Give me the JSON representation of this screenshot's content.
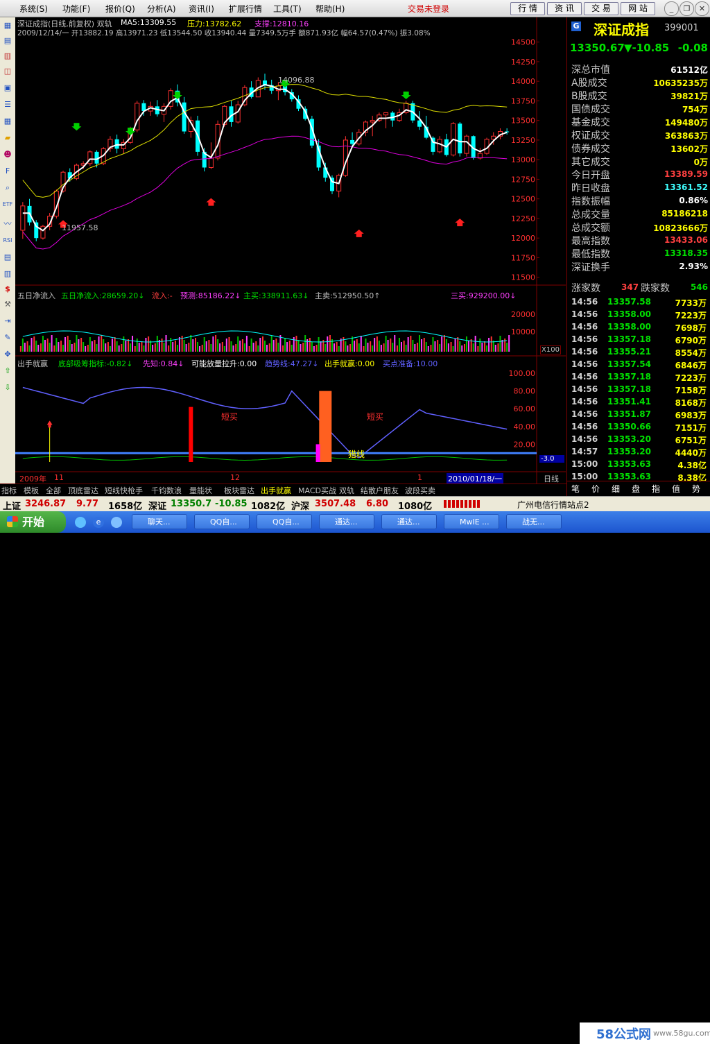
{
  "menu": {
    "items": [
      "系统(S)",
      "功能(F)",
      "报价(Q)",
      "分析(A)",
      "资讯(I)",
      "扩展行情",
      "工具(T)",
      "帮助(H)"
    ],
    "notice": "交易未登录",
    "buttons": [
      "行 情",
      "资 讯",
      "交 易",
      "网 站"
    ]
  },
  "chart_header": {
    "title": "深证成指(日线,前复权) 双轨",
    "ma5": "MA5:13309.55",
    "pressure": "压力:13782.62",
    "support": "支撑:12810.16",
    "ohlc_line": "2009/12/14/一 开13882.19 高13971.23 低13544.50 收13940.44 量7349.5万手 额871.93亿 幅64.57(0.47%) 振3.08%",
    "high_mark": "14096.88",
    "low_mark": "11957.58"
  },
  "chart_data": [
    {
      "type": "candlestick",
      "title": "深证成指(日线,前复权) 双轨",
      "ylim": [
        11400,
        14550
      ],
      "y_ticks": [
        14500,
        14250,
        14000,
        13750,
        13500,
        13250,
        13000,
        12750,
        12500,
        12250,
        12000,
        11750,
        11500
      ],
      "candles": [
        [
          12100,
          12460,
          11990,
          12410
        ],
        [
          12410,
          12500,
          12160,
          12200
        ],
        [
          12200,
          12230,
          11960,
          12000
        ],
        [
          12000,
          12170,
          11980,
          12150
        ],
        [
          12150,
          12320,
          12100,
          12280
        ],
        [
          12280,
          12620,
          12250,
          12600
        ],
        [
          12600,
          12860,
          12580,
          12840
        ],
        [
          12840,
          12890,
          12720,
          12760
        ],
        [
          12760,
          12950,
          12740,
          12930
        ],
        [
          12930,
          12980,
          12880,
          12950
        ],
        [
          12950,
          13120,
          12920,
          13100
        ],
        [
          13100,
          13120,
          12900,
          12950
        ],
        [
          12950,
          13160,
          12930,
          13140
        ],
        [
          13140,
          13300,
          13100,
          13260
        ],
        [
          13260,
          13320,
          13080,
          13140
        ],
        [
          13140,
          13260,
          13080,
          13220
        ],
        [
          13220,
          13420,
          13200,
          13380
        ],
        [
          13380,
          13750,
          13350,
          13720
        ],
        [
          13720,
          13760,
          13560,
          13620
        ],
        [
          13620,
          13740,
          13560,
          13680
        ],
        [
          13680,
          13760,
          13550,
          13580
        ],
        [
          13580,
          13720,
          13480,
          13680
        ],
        [
          13680,
          13910,
          13640,
          13880
        ],
        [
          13880,
          13960,
          13680,
          13730
        ],
        [
          13730,
          13800,
          13330,
          13360
        ],
        [
          13360,
          13550,
          13280,
          13500
        ],
        [
          13500,
          13560,
          13050,
          13100
        ],
        [
          13100,
          13150,
          12850,
          12900
        ],
        [
          12900,
          13220,
          12880,
          13020
        ],
        [
          13020,
          13500,
          12990,
          13450
        ],
        [
          13450,
          13700,
          13420,
          13680
        ],
        [
          13680,
          13750,
          13420,
          13480
        ],
        [
          13480,
          13750,
          13460,
          13700
        ],
        [
          13700,
          13950,
          13680,
          13920
        ],
        [
          13920,
          14000,
          13780,
          13800
        ],
        [
          13800,
          14050,
          13800,
          14010
        ],
        [
          14010,
          14097,
          13890,
          13950
        ],
        [
          13950,
          14020,
          13840,
          13880
        ],
        [
          13880,
          13990,
          13760,
          13940
        ],
        [
          13940,
          13980,
          13820,
          13860
        ],
        [
          13860,
          13900,
          13740,
          13770
        ],
        [
          13770,
          13820,
          13620,
          13650
        ],
        [
          13650,
          13680,
          13500,
          13520
        ],
        [
          13520,
          13560,
          13150,
          13180
        ],
        [
          13180,
          13260,
          12860,
          12900
        ],
        [
          12900,
          12960,
          12720,
          12770
        ],
        [
          12770,
          12800,
          12560,
          12600
        ],
        [
          12600,
          12820,
          12520,
          12800
        ],
        [
          12800,
          13300,
          12780,
          13250
        ],
        [
          13250,
          13350,
          13150,
          13200
        ],
        [
          13200,
          13390,
          13180,
          13350
        ],
        [
          13350,
          13500,
          13300,
          13480
        ],
        [
          13480,
          13560,
          13300,
          13500
        ],
        [
          13500,
          13600,
          13480,
          13570
        ],
        [
          13570,
          13600,
          13400,
          13600
        ],
        [
          13600,
          13620,
          13420,
          13500
        ],
        [
          13500,
          13650,
          13480,
          13600
        ],
        [
          13600,
          13750,
          13580,
          13720
        ],
        [
          13720,
          13750,
          13470,
          13500
        ],
        [
          13500,
          13620,
          13380,
          13420
        ],
        [
          13420,
          13560,
          13260,
          13280
        ],
        [
          13280,
          13300,
          13060,
          13100
        ],
        [
          13100,
          13300,
          13080,
          13260
        ],
        [
          13260,
          13330,
          13040,
          13060
        ],
        [
          13060,
          13480,
          13040,
          13460
        ],
        [
          13460,
          13480,
          13040,
          13080
        ],
        [
          13080,
          13320,
          13040,
          13300
        ],
        [
          13300,
          13310,
          13000,
          13020
        ],
        [
          13020,
          13150,
          13000,
          13080
        ],
        [
          13080,
          13280,
          13060,
          13260
        ],
        [
          13260,
          13350,
          13190,
          13300
        ],
        [
          13300,
          13400,
          13260,
          13360
        ],
        [
          13360,
          13400,
          13320,
          13350
        ]
      ]
    },
    {
      "type": "bar",
      "title": "五日净流入",
      "series": [
        {
          "name": "五日净流入",
          "value": "28659.20"
        },
        {
          "name": "流入",
          "value": "-"
        },
        {
          "name": "预测",
          "value": "85186.22"
        },
        {
          "name": "主买",
          "value": "338911.63"
        },
        {
          "name": "主卖",
          "value": "512950.50"
        },
        {
          "name": "三买",
          "value": "929200.00"
        }
      ],
      "y_ticks": [
        20000,
        10000
      ],
      "unit": "X100"
    },
    {
      "type": "line",
      "title": "出手就赢",
      "series": [
        {
          "name": "底部吸筹指标",
          "value": "-0.82"
        },
        {
          "name": "先知",
          "value": "0.84"
        },
        {
          "name": "可能放量拉升",
          "value": "0.00"
        },
        {
          "name": "趋势线",
          "value": "47.27"
        },
        {
          "name": "出手就赢",
          "value": "0.00"
        },
        {
          "name": "买点准备",
          "value": "10.00"
        }
      ],
      "y_ticks": [
        100.0,
        80.0,
        60.0,
        40.0,
        20.0
      ],
      "current_value": "-3.0",
      "annotations": [
        "短买",
        "短买",
        "猎线"
      ]
    }
  ],
  "dates": {
    "d1": "2009年",
    "d2": "11",
    "d3": "12",
    "d4": "1",
    "d5": "2010/01/18/一",
    "period": "日线"
  },
  "right_panel": {
    "badge": "G",
    "name": "深证成指",
    "code": "399001",
    "price": "13350.67",
    "arrow_change": "▼-10.85",
    "pct": "-0.08",
    "rows": [
      {
        "label": "深总市值",
        "value": "61512亿",
        "color": "#ffffff"
      },
      {
        "label": "A股成交",
        "value": "10635235万",
        "color": "#ffff00"
      },
      {
        "label": "B股成交",
        "value": "39821万",
        "color": "#ffff00"
      },
      {
        "label": "国债成交",
        "value": "754万",
        "color": "#ffff00"
      },
      {
        "label": "基金成交",
        "value": "149480万",
        "color": "#ffff00"
      },
      {
        "label": "权证成交",
        "value": "363863万",
        "color": "#ffff00"
      },
      {
        "label": "债券成交",
        "value": "13602万",
        "color": "#ffff00"
      },
      {
        "label": "其它成交",
        "value": "0万",
        "color": "#ffff00"
      },
      {
        "label": "今日开盘",
        "value": "13389.59",
        "color": "#ff4040"
      },
      {
        "label": "昨日收盘",
        "value": "13361.52",
        "color": "#40ffff"
      },
      {
        "label": "指数振幅",
        "value": "0.86%",
        "color": "#ffffff"
      },
      {
        "label": "总成交量",
        "value": "85186218",
        "color": "#ffff00"
      },
      {
        "label": "总成交额",
        "value": "10823666万",
        "color": "#ffff00"
      },
      {
        "label": "最高指数",
        "value": "13433.06",
        "color": "#ff4040"
      },
      {
        "label": "最低指数",
        "value": "13318.35",
        "color": "#00e000"
      },
      {
        "label": "深证换手",
        "value": "2.93%",
        "color": "#ffffff"
      }
    ],
    "up_label": "涨家数",
    "up_count": "347",
    "down_label": "跌家数",
    "down_count": "546",
    "ticks": [
      {
        "t": "14:56",
        "p": "13357.58",
        "v": "7733万"
      },
      {
        "t": "14:56",
        "p": "13358.00",
        "v": "7223万"
      },
      {
        "t": "14:56",
        "p": "13358.00",
        "v": "7698万"
      },
      {
        "t": "14:56",
        "p": "13357.18",
        "v": "6790万"
      },
      {
        "t": "14:56",
        "p": "13355.21",
        "v": "8554万"
      },
      {
        "t": "14:56",
        "p": "13357.54",
        "v": "6846万"
      },
      {
        "t": "14:56",
        "p": "13357.18",
        "v": "7223万"
      },
      {
        "t": "14:56",
        "p": "13357.18",
        "v": "7158万"
      },
      {
        "t": "14:56",
        "p": "13351.41",
        "v": "8168万"
      },
      {
        "t": "14:56",
        "p": "13351.87",
        "v": "6983万"
      },
      {
        "t": "14:56",
        "p": "13350.66",
        "v": "7151万"
      },
      {
        "t": "14:56",
        "p": "13353.20",
        "v": "6751万"
      },
      {
        "t": "14:57",
        "p": "13353.20",
        "v": "4440万"
      },
      {
        "t": "15:00",
        "p": "13353.63",
        "v": "4.38亿"
      },
      {
        "t": "15:00",
        "p": "13353.63",
        "v": "8.38亿"
      }
    ],
    "bottom_tabs": [
      "笔",
      "价",
      "细",
      "盘",
      "指",
      "值",
      "势"
    ]
  },
  "tabs": [
    "指标",
    "模板",
    "全部",
    "顶底雷达",
    "短线快枪手",
    "千钧数浪",
    "量能状",
    "板块雷达",
    "出手就赢",
    "MACD买战",
    "双轨",
    "结散户朋友",
    "波段买卖"
  ],
  "status": {
    "sh_label": "上证",
    "sh_val": "3246.87",
    "sh_chg": "9.77",
    "sh_amt": "1658亿",
    "sz_label": "深证",
    "sz_val": "13350.7",
    "sz_chg": "-10.85",
    "sz_amt": "1082亿",
    "hs_label": "沪深",
    "hs_val": "3507.48",
    "hs_chg": "6.80",
    "hs_amt": "1080亿",
    "station": "广州电信行情站点2"
  },
  "taskbar": {
    "start": "开始",
    "tasks": [
      "聊天...",
      "QQ自...",
      "QQ自...",
      "通达...",
      "通达...",
      "MwIE ...",
      "战无..."
    ],
    "watermark": "58公式网",
    "watermark_url": "www.58gu.com"
  }
}
